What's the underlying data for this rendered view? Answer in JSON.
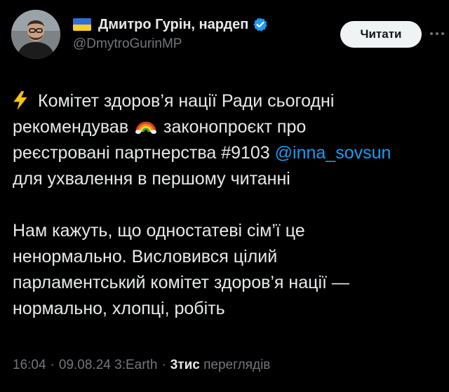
{
  "author": {
    "display_name": "Дмитро Гурін, нардеп",
    "handle": "@DmytroGurinMP",
    "flag_icon": "ukraine-flag-icon",
    "verified_icon": "verified-badge-icon",
    "avatar_icon": "profile-photo-avatar"
  },
  "header": {
    "follow_label": "Читати",
    "more_icon": "more-options-icon"
  },
  "tweet": {
    "paragraph1": {
      "line1_icon": "lightning-bolt-icon",
      "line1_text": "Комітет здоров’я нації Ради сьогодні",
      "line2_text_a": "рекомендував",
      "line2_icon": "rainbow-icon",
      "line2_text_b": "законопроєкт про",
      "line3_text": "реєстровані партнерства #9103",
      "line3_mention": "@inna_sovsun",
      "line4_text": "для ухвалення в першому читанні"
    },
    "paragraph2": {
      "line1": "Нам кажуть, що одностатеві сім’ї це",
      "line2": "ненормально. Висловився цілий",
      "line3": "парламентський комітет здоров’я нації —",
      "line4": "нормально, хлопці, робіть"
    }
  },
  "meta": {
    "time": "16:04",
    "date": "09.08.24",
    "source": "3:Earth",
    "views_count": "3тис",
    "views_label": "переглядів",
    "separator": "·"
  },
  "colors": {
    "background": "#000000",
    "text": "#e7e9ea",
    "secondary": "#71767b",
    "link": "#1d9bf0",
    "button_bg": "#eff3f4"
  }
}
